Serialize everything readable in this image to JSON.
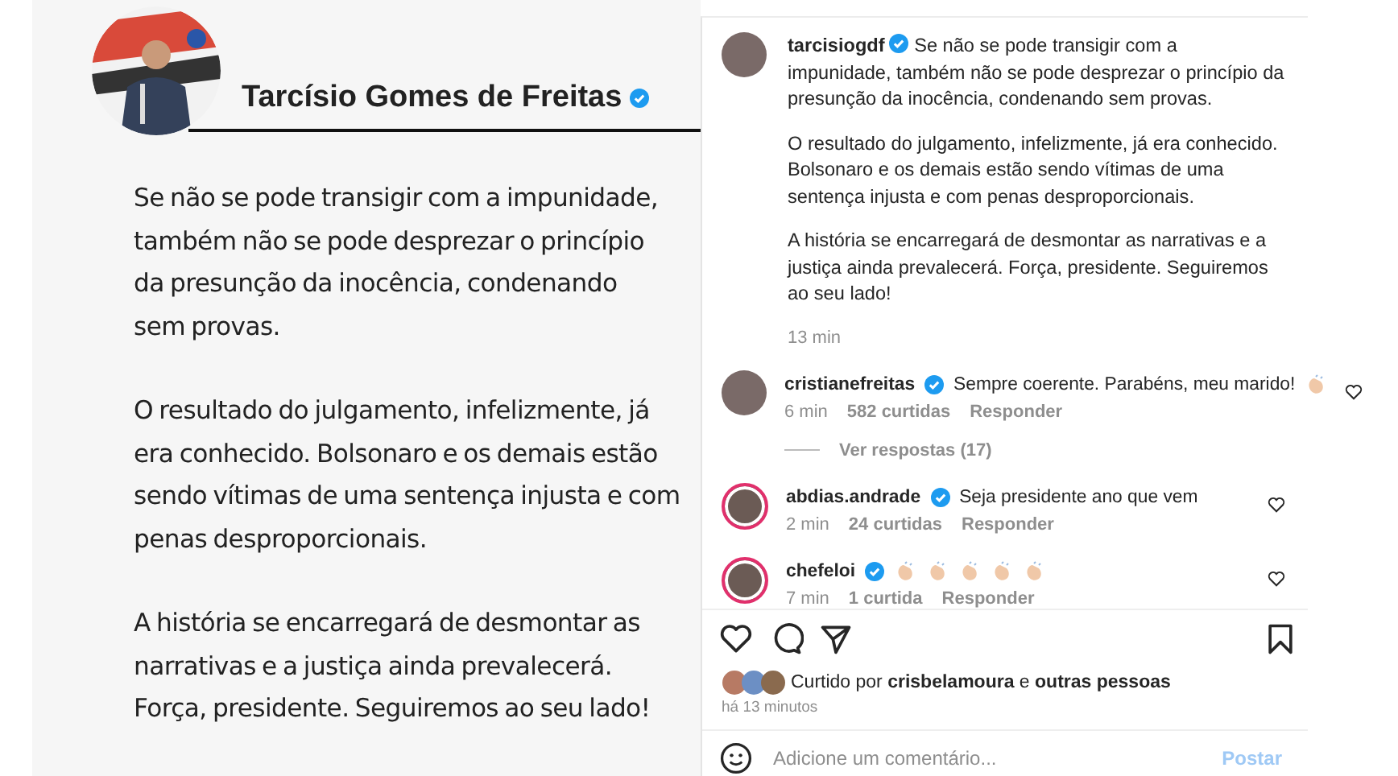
{
  "image_post": {
    "name": "Tarcísio Gomes de Freitas",
    "verified": true,
    "paragraphs": [
      "Se não se pode transigir com a impunidade,\ntambém não se pode desprezar o princípio\nda presunção da inocência, condenando\nsem provas.",
      "O resultado do julgamento, infelizmente, já\nera conhecido. Bolsonaro e os demais estão\nsendo vítimas de uma sentença injusta e com\npenas desproporcionais.",
      "A história se encarregará de desmontar as\nnarrativas e a justiça ainda prevalecerá.\nForça, presidente. Seguiremos ao seu lado!"
    ]
  },
  "caption": {
    "username": "tarcisiogdf",
    "verified": true,
    "paragraphs": [
      "Se não se pode transigir com a impunidade, também não se pode desprezar o princípio da presunção da inocência, condenando sem provas.",
      "O resultado do julgamento, infelizmente, já era conhecido. Bolsonaro e os demais estão sendo vítimas de uma sentença injusta e com penas desproporcionais.",
      "A história se encarregará de desmontar as narrativas e a justiça ainda prevalecerá. Força, presidente. Seguiremos ao seu lado!"
    ],
    "time": "13 min"
  },
  "comments": [
    {
      "username": "cristianefreitas",
      "verified": true,
      "text": "Sempre coerente. Parabéns, meu marido!",
      "emojis": [
        {
          "kind": "clap"
        }
      ],
      "story_ring": false,
      "time": "6 min",
      "likes": "582 curtidas",
      "reply": "Responder",
      "replies": "Ver respostas (17)"
    },
    {
      "username": "abdias.andrade",
      "verified": true,
      "text": "Seja presidente ano que vem",
      "story_ring": true,
      "time": "2 min",
      "likes": "24 curtidas",
      "reply": "Responder"
    },
    {
      "username": "chefeloi",
      "verified": true,
      "emojis": [
        {
          "kind": "clap"
        },
        {
          "kind": "clap"
        },
        {
          "kind": "clap"
        },
        {
          "kind": "clap"
        },
        {
          "kind": "clap"
        }
      ],
      "story_ring": true,
      "time": "7 min",
      "likes": "1 curtida",
      "reply": "Responder"
    }
  ],
  "likes": {
    "prefix": "Curtido por",
    "user": "crisbelamoura",
    "joiner": "e",
    "others": "outras pessoas",
    "time": "há 13 minutos"
  },
  "comment_box": {
    "placeholder": "Adicione um comentário...",
    "button": "Postar"
  }
}
